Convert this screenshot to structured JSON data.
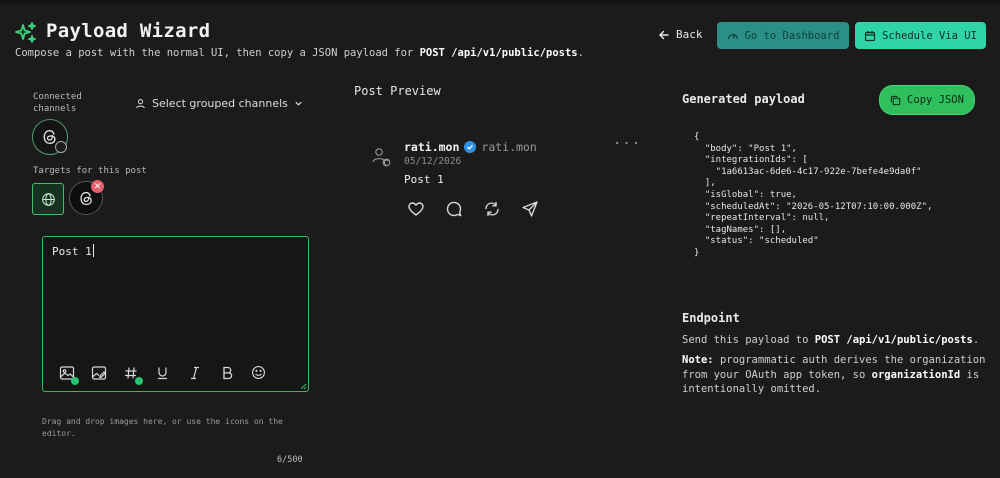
{
  "header": {
    "title": "Payload Wizard",
    "subtitle_prefix": "Compose a post with the normal UI, then copy a JSON payload for",
    "subtitle_endpoint": "POST /api/v1/public/posts",
    "subtitle_suffix": ".",
    "back_label": "Back",
    "dashboard_label": "Go to Dashboard",
    "schedule_label": "Schedule Via UI"
  },
  "left": {
    "connected_label": "Connected channels",
    "select_grouped_label": "Select grouped channels",
    "targets_label": "Targets for this post",
    "editor_text": "Post 1",
    "drag_hint": "Drag and drop images here, or use the icons on the editor.",
    "char_count": "6/500"
  },
  "preview": {
    "title": "Post Preview",
    "name": "rati.mon",
    "handle": "rati.mon",
    "date": "05/12/2026",
    "more": "···",
    "body": "Post 1"
  },
  "payload": {
    "title": "Generated payload",
    "copy_label": "Copy JSON",
    "json_text": "{\n  \"body\": \"Post 1\",\n  \"integrationIds\": [\n    \"1a6613ac-6de6-4c17-922e-7befe4e9da0f\"\n  ],\n  \"isGlobal\": true,\n  \"scheduledAt\": \"2026-05-12T07:10:00.000Z\",\n  \"repeatInterval\": null,\n  \"tagNames\": [],\n  \"status\": \"scheduled\"\n}"
  },
  "endpoint": {
    "title": "Endpoint",
    "send_prefix": "Send this payload to",
    "send_endpoint": "POST /api/v1/public/posts",
    "send_suffix": ".",
    "note_label": "Note:",
    "note_text_1": "programmatic auth derives the organization from your OAuth app token, so",
    "note_field": "organizationId",
    "note_text_2": "is intentionally omitted."
  },
  "icons": {
    "logo": "sparkle-icon",
    "back": "arrow-left-icon",
    "dashboard": "speedometer-icon",
    "schedule": "calendar-icon",
    "user": "user-icon",
    "chevron": "chevron-down-icon",
    "threads": "threads-icon",
    "globe": "globe-icon",
    "close": "close-icon",
    "insert_media": "image-icon",
    "edit_image": "image-edit-icon",
    "hashtag": "hashtag-icon",
    "underline": "underline-icon",
    "italic": "italic-icon",
    "bold": "bold-icon",
    "emoji": "emoji-icon",
    "verified": "verified-badge-icon",
    "heart": "heart-icon",
    "comment": "comment-icon",
    "repost": "repost-icon",
    "share": "send-icon",
    "copy": "copy-icon"
  },
  "colors": {
    "accent_green": "#2fbf5d",
    "teal_button": "#2a8f86",
    "mint_button": "#2fd5a6",
    "remove_red": "#e4626b",
    "verified_blue": "#2f8fe6"
  }
}
